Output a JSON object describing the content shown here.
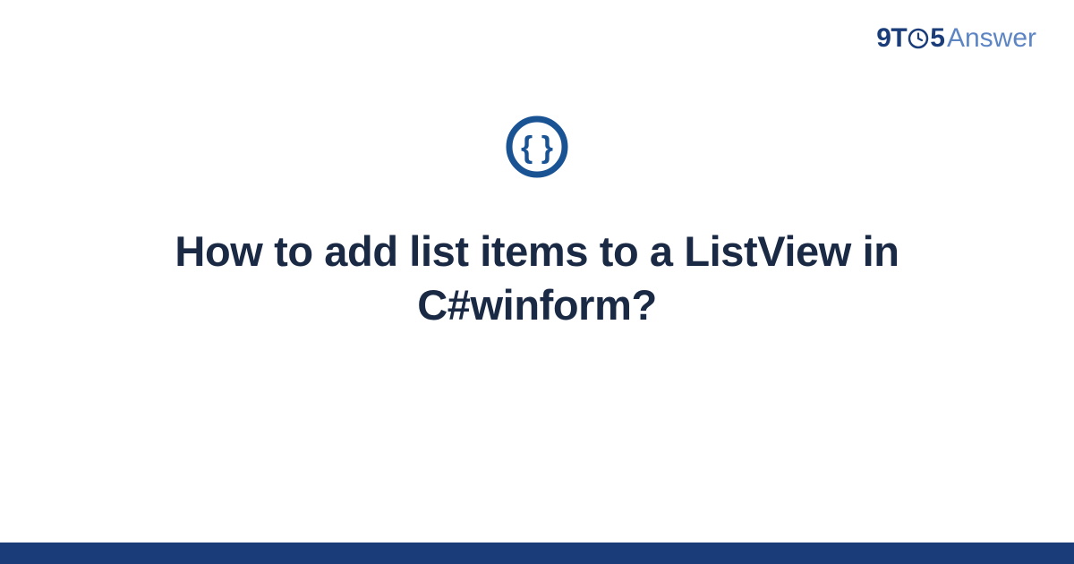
{
  "brand": {
    "part1": "9T",
    "part2": "5",
    "part3": "Answer"
  },
  "icon": {
    "name": "braces-icon"
  },
  "question": {
    "title": "How to add list items to a ListView in C#winform?"
  },
  "colors": {
    "primary": "#1a3d7a",
    "secondary": "#5d85c4",
    "heading": "#1a2944"
  }
}
